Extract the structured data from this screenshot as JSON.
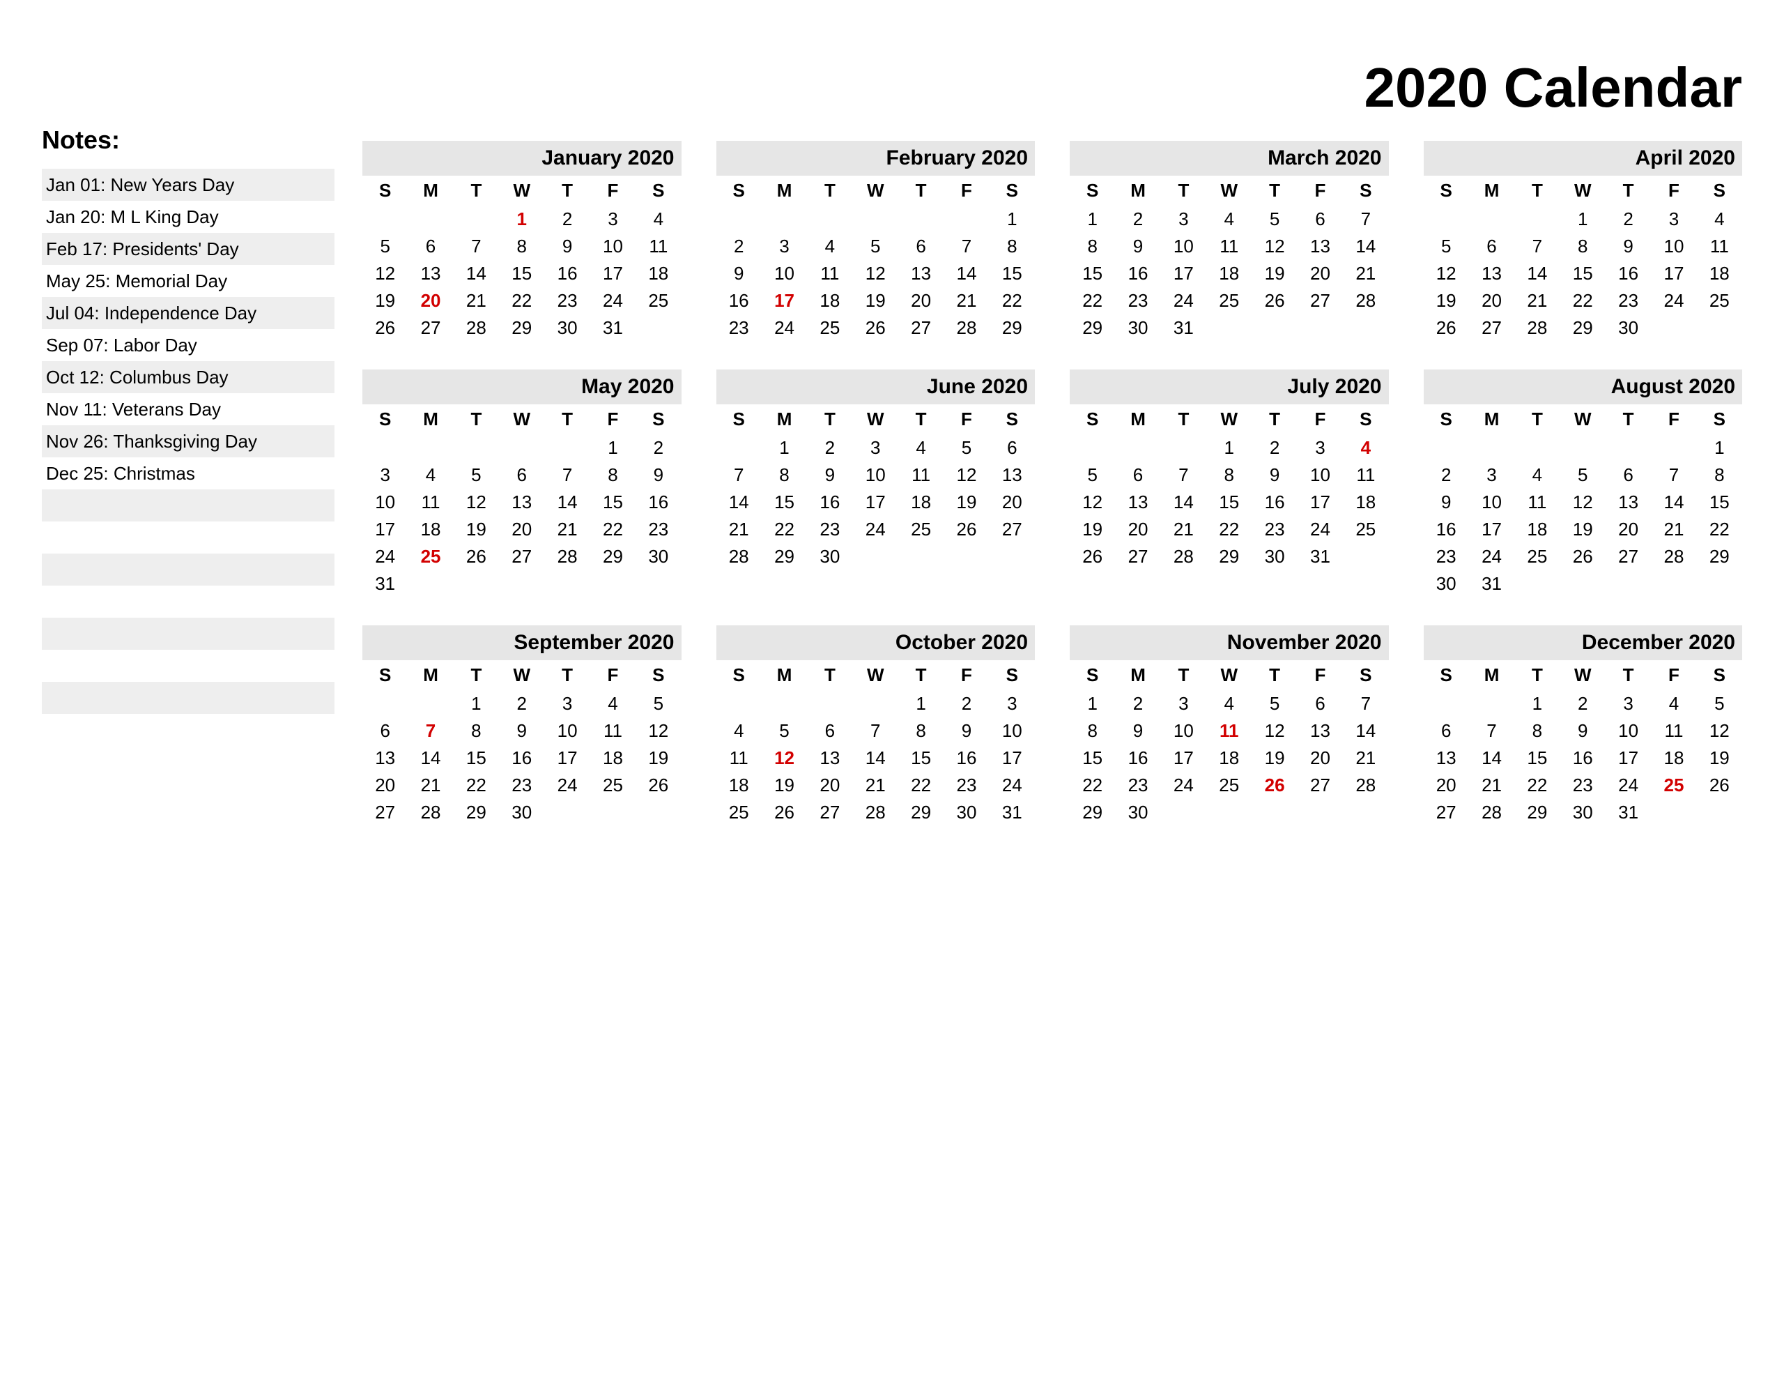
{
  "title": "2020 Calendar",
  "notes_label": "Notes:",
  "notes": [
    "Jan 01: New Years Day",
    "Jan 20: M L King Day",
    "Feb 17: Presidents' Day",
    "May 25: Memorial Day",
    "Jul 04: Independence Day",
    "Sep 07: Labor Day",
    "Oct 12: Columbus Day",
    "Nov 11: Veterans Day",
    "Nov 26: Thanksgiving Day",
    "Dec 25: Christmas",
    "",
    "",
    "",
    "",
    "",
    "",
    ""
  ],
  "dow": [
    "S",
    "M",
    "T",
    "W",
    "T",
    "F",
    "S"
  ],
  "months": [
    {
      "name": "January 2020",
      "start": 3,
      "days": 31,
      "holidays": [
        1,
        20
      ]
    },
    {
      "name": "February 2020",
      "start": 6,
      "days": 29,
      "holidays": [
        17
      ]
    },
    {
      "name": "March 2020",
      "start": 0,
      "days": 31,
      "holidays": []
    },
    {
      "name": "April 2020",
      "start": 3,
      "days": 30,
      "holidays": []
    },
    {
      "name": "May 2020",
      "start": 5,
      "days": 31,
      "holidays": [
        25
      ]
    },
    {
      "name": "June 2020",
      "start": 1,
      "days": 30,
      "holidays": []
    },
    {
      "name": "July 2020",
      "start": 3,
      "days": 31,
      "holidays": [
        4
      ]
    },
    {
      "name": "August 2020",
      "start": 6,
      "days": 31,
      "holidays": []
    },
    {
      "name": "September 2020",
      "start": 2,
      "days": 30,
      "holidays": [
        7
      ]
    },
    {
      "name": "October 2020",
      "start": 4,
      "days": 31,
      "holidays": [
        12
      ]
    },
    {
      "name": "November 2020",
      "start": 0,
      "days": 30,
      "holidays": [
        11,
        26
      ]
    },
    {
      "name": "December 2020",
      "start": 2,
      "days": 31,
      "holidays": [
        25
      ]
    }
  ]
}
